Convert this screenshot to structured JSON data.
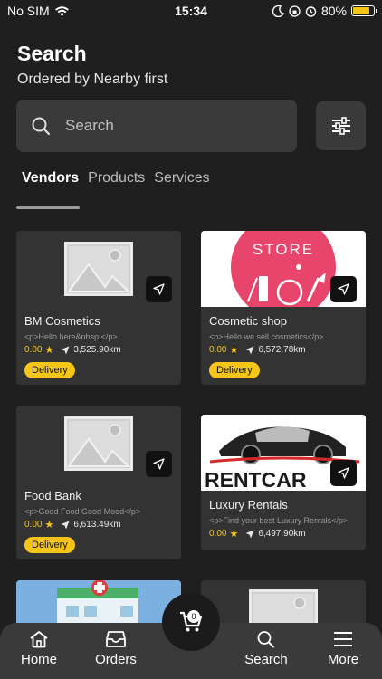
{
  "status_bar": {
    "carrier": "No SIM",
    "time": "15:34",
    "battery": "80%",
    "battery_level": 0.8
  },
  "header": {
    "title": "Search",
    "subtitle": "Ordered by Nearby first"
  },
  "search": {
    "placeholder": "Search"
  },
  "tabs": [
    {
      "label": "Vendors",
      "active": true
    },
    {
      "label": "Products",
      "active": false
    },
    {
      "label": "Services",
      "active": false
    }
  ],
  "vendors": [
    {
      "name": "BM Cosmetics",
      "description": "<p>Hello here&nbsp;</p>",
      "rating": "0.00",
      "distance": "3,525.90km",
      "badge": "Delivery",
      "image": "placeholder"
    },
    {
      "name": "Cosmetic shop",
      "description": "<p>Hello we sell cosmetics</p>",
      "rating": "0.00",
      "distance": "6,572.78km",
      "badge": "Delivery",
      "image": "store",
      "image_text": "STORE"
    },
    {
      "name": "Food Bank",
      "description": "<p>Good Food Good Mood</p>",
      "rating": "0.00",
      "distance": "6,613.49km",
      "badge": "Delivery",
      "image": "placeholder"
    },
    {
      "name": "Luxury Rentals",
      "description": "<p>Find your best Luxury Rentals</p>",
      "rating": "0.00",
      "distance": "6,497.90km",
      "image": "rentcar",
      "image_text": "RENTCAR"
    }
  ],
  "cart": {
    "count": "0"
  },
  "bottom_nav": [
    {
      "label": "Home",
      "icon": "home-icon"
    },
    {
      "label": "Orders",
      "icon": "inbox-icon"
    },
    {
      "label": "Search",
      "icon": "search-icon"
    },
    {
      "label": "More",
      "icon": "menu-icon"
    }
  ],
  "colors": {
    "accent": "#f5c518",
    "background": "#1f1f1f",
    "card": "#333333"
  }
}
